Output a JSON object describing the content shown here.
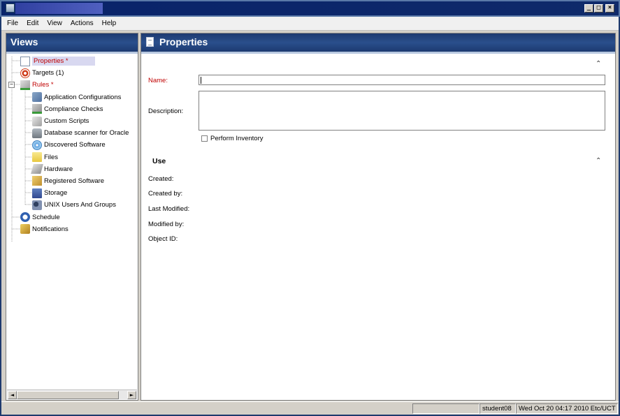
{
  "menu": [
    "File",
    "Edit",
    "View",
    "Actions",
    "Help"
  ],
  "window_buttons": {
    "minimize": "_",
    "maximize": "□",
    "close": "×"
  },
  "left_panel": {
    "title": "Views",
    "tree": [
      {
        "label": "Properties *",
        "level": 0,
        "selected": true,
        "red": true,
        "icon": "document-icon"
      },
      {
        "label": "Targets (1)",
        "level": 0,
        "icon": "target-icon"
      },
      {
        "label": "Rules *",
        "level": 0,
        "red": true,
        "expander": "−",
        "icon": "rules-check-icon"
      },
      {
        "label": "Application Configurations",
        "level": 1,
        "icon": "app-config-icon"
      },
      {
        "label": "Compliance Checks",
        "level": 1,
        "icon": "compliance-check-icon"
      },
      {
        "label": "Custom Scripts",
        "level": 1,
        "icon": "script-icon"
      },
      {
        "label": "Database scanner for Oracle",
        "level": 1,
        "icon": "database-icon"
      },
      {
        "label": "Discovered Software",
        "level": 1,
        "icon": "disc-icon"
      },
      {
        "label": "Files",
        "level": 1,
        "icon": "folder-icon"
      },
      {
        "label": "Hardware",
        "level": 1,
        "icon": "hardware-icon"
      },
      {
        "label": "Registered Software",
        "level": 1,
        "icon": "package-icon"
      },
      {
        "label": "Storage",
        "level": 1,
        "icon": "storage-icon"
      },
      {
        "label": "UNIX Users And Groups",
        "level": 1,
        "icon": "users-icon"
      },
      {
        "label": "Schedule",
        "level": 0,
        "icon": "clock-icon"
      },
      {
        "label": "Notifications",
        "level": 0,
        "icon": "notification-icon"
      }
    ],
    "scroll_left": "◄",
    "scroll_right": "►"
  },
  "right_panel": {
    "title": "Properties",
    "collapse_glyph": "⌃",
    "name_label": "Name:",
    "description_label": "Description:",
    "perform_inventory_label": "Perform Inventory",
    "use_section_title": "Use",
    "use_fields": [
      "Created:",
      "Created by:",
      "Last Modified:",
      "Modified by:",
      "Object ID:"
    ]
  },
  "status": {
    "user": "student08",
    "datetime": "Wed Oct 20 04:17 2010 Etc/UCT"
  },
  "colors": {
    "header_blue": "#1d3a70",
    "required_red": "#c00000",
    "selection": "#d8d8f0"
  }
}
